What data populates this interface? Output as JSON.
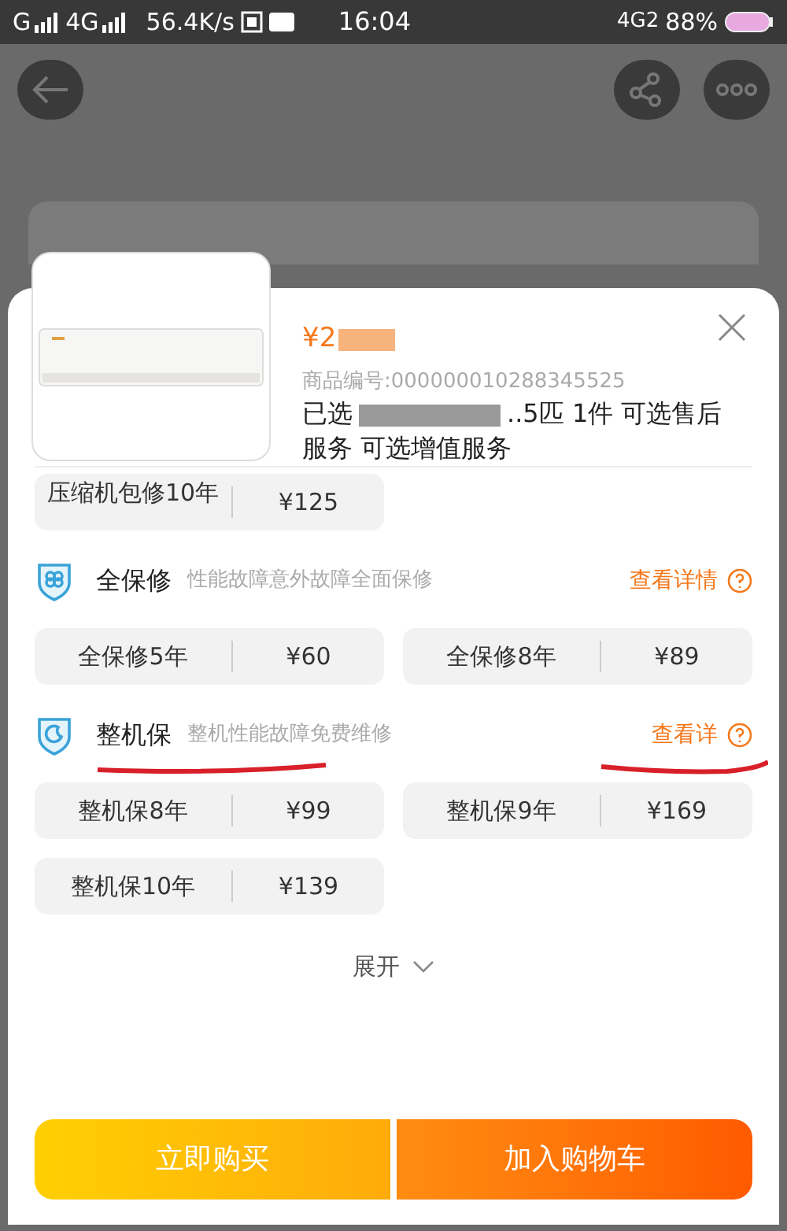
{
  "status_bar": {
    "left": [
      "G",
      "4G"
    ],
    "speed": "56.4K/s",
    "time": "16:04",
    "network": "4G2",
    "battery": "88%"
  },
  "product": {
    "price": "¥2",
    "code": "商品编号:000000010288345525",
    "selected_prefix": "已选",
    "selected_rest": "..5匹 1件 可选售后服务 可选增值服务"
  },
  "partial_option": {
    "label": "压缩机包修10年",
    "price": "¥125"
  },
  "sections": [
    {
      "kind": "shield-clover",
      "title": "全保修",
      "subtitle": "性能故障意外故障全面保修",
      "link": "查看详情",
      "underlined": false,
      "options": [
        {
          "label": "全保修5年",
          "price": "¥60"
        },
        {
          "label": "全保修8年",
          "price": "¥89"
        }
      ]
    },
    {
      "kind": "shield-moon",
      "title": "整机保",
      "subtitle": "整机性能故障免费维修",
      "link": "查看详",
      "underlined": true,
      "options": [
        {
          "label": "整机保8年",
          "price": "¥99"
        },
        {
          "label": "整机保9年",
          "price": "¥169"
        },
        {
          "label": "整机保10年",
          "price": "¥139"
        }
      ]
    }
  ],
  "expand": "展开",
  "buttons": [
    {
      "label": "立即购买",
      "kind": "buy"
    },
    {
      "label": "加入购物车",
      "kind": "cart"
    }
  ]
}
